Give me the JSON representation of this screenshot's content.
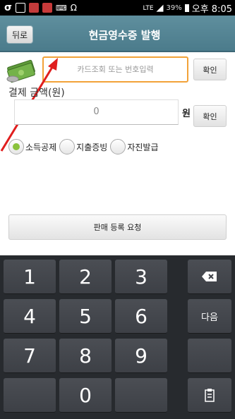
{
  "status_bar": {
    "network": "LTE",
    "battery": "39%",
    "time": "오후 8:05",
    "colors": {
      "ico1": "#c23b3b",
      "ico2": "#c73a3a"
    }
  },
  "header": {
    "back_label": "뒤로",
    "title": "현금영수증 발행"
  },
  "card": {
    "placeholder": "카드조회 또는 번호입력",
    "confirm_label": "확인"
  },
  "amount": {
    "label": "결제 금액(원)",
    "value": "0",
    "unit": "원",
    "confirm_label": "확인"
  },
  "radios": [
    {
      "label": "소득공제",
      "selected": true
    },
    {
      "label": "지출증빙",
      "selected": false
    },
    {
      "label": "자진발급",
      "selected": false
    }
  ],
  "register_label": "판매 등록 요청",
  "keyboard": {
    "keys": [
      "1",
      "2",
      "3",
      "backspace",
      "4",
      "5",
      "6",
      "다음",
      "7",
      "8",
      "9",
      "",
      "",
      "0",
      "",
      "clipboard"
    ]
  }
}
